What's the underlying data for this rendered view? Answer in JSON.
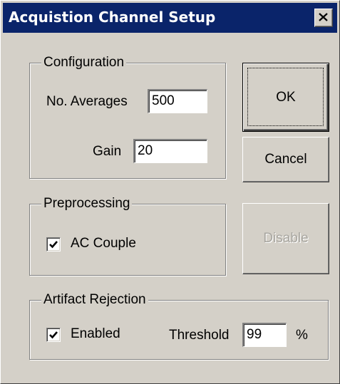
{
  "window": {
    "title": "Acquistion Channel Setup",
    "close_glyph": "×"
  },
  "configuration": {
    "group_label": "Configuration",
    "averages_label": "No. Averages",
    "averages_value": "500",
    "gain_label": "Gain",
    "gain_value": "20"
  },
  "preprocessing": {
    "group_label": "Preprocessing",
    "ac_couple_label": "AC Couple",
    "ac_couple_checked": true
  },
  "artifact_rejection": {
    "group_label": "Artifact Rejection",
    "enabled_label": "Enabled",
    "enabled_checked": true,
    "threshold_label": "Threshold",
    "threshold_value": "99",
    "threshold_unit": "%"
  },
  "buttons": {
    "ok": "OK",
    "cancel": "Cancel",
    "disable": "Disable"
  },
  "colors": {
    "titlebar": "#0a246a",
    "face": "#d4d0c8",
    "disabled_text": "#a8a6a0"
  }
}
